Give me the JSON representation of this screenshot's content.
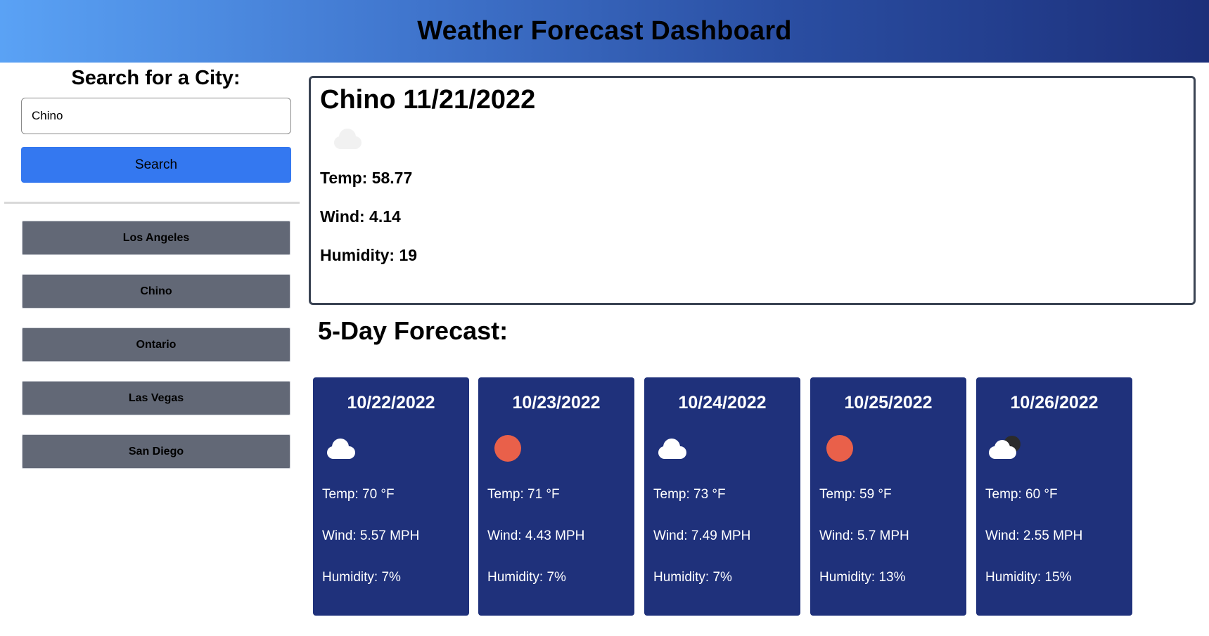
{
  "header": {
    "title": "Weather Forecast Dashboard"
  },
  "search": {
    "title": "Search for a City:",
    "input_value": "Chino",
    "button_label": "Search"
  },
  "history": [
    "Los Angeles",
    "Chino",
    "Ontario",
    "Las Vegas",
    "San Diego"
  ],
  "current": {
    "title": "Chino 11/21/2022",
    "icon": "cloud-icon",
    "temp": "Temp: 58.77",
    "wind": "Wind: 4.14",
    "humidity": "Humidity: 19"
  },
  "forecast": {
    "title": "5-Day Forecast:",
    "days": [
      {
        "date": "10/22/2022",
        "icon": "cloud-icon",
        "temp": "Temp: 70 °F",
        "wind": "Wind: 5.57 MPH",
        "humidity": "Humidity: 7%"
      },
      {
        "date": "10/23/2022",
        "icon": "sun-icon",
        "temp": "Temp: 71 °F",
        "wind": "Wind: 4.43 MPH",
        "humidity": "Humidity: 7%"
      },
      {
        "date": "10/24/2022",
        "icon": "cloud-icon",
        "temp": "Temp: 73 °F",
        "wind": "Wind: 7.49 MPH",
        "humidity": "Humidity: 7%"
      },
      {
        "date": "10/25/2022",
        "icon": "sun-icon",
        "temp": "Temp: 59 °F",
        "wind": "Wind: 5.7 MPH",
        "humidity": "Humidity: 13%"
      },
      {
        "date": "10/26/2022",
        "icon": "cloud-moon-icon",
        "temp": "Temp: 60 °F",
        "wind": "Wind: 2.55 MPH",
        "humidity": "Humidity: 15%"
      }
    ]
  },
  "colors": {
    "header_start": "#5aa2f5",
    "header_end": "#1c2f7a",
    "search_button": "#3478f0",
    "history_button": "#626876",
    "card_background": "#1f317b",
    "sun": "#e9604a"
  }
}
